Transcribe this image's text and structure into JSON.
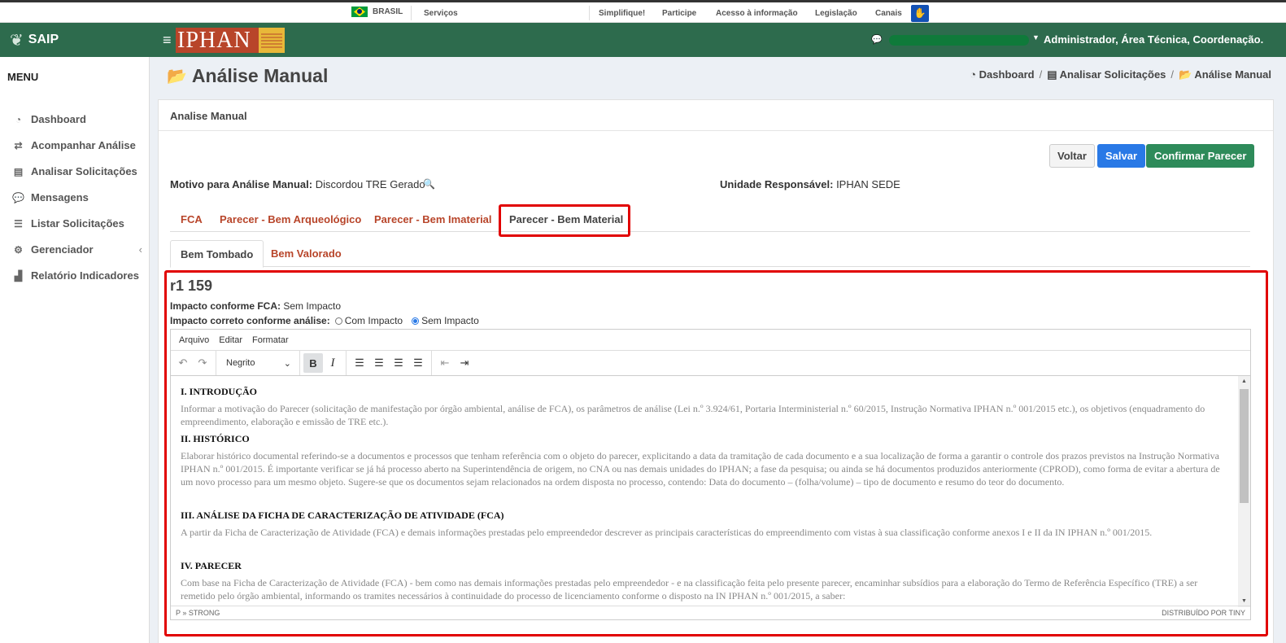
{
  "gov": {
    "country": "BRASIL",
    "links": [
      "Serviços",
      "Simplifique!",
      "Participe",
      "Acesso à informação",
      "Legislação",
      "Canais"
    ]
  },
  "app": {
    "name": "SAIP",
    "logo_text": "IPHAN"
  },
  "navbar": {
    "user": "Administrador, Área Técnica, Coordenação..."
  },
  "sidebar": {
    "title": "MENU",
    "items": [
      {
        "label": "Dashboard",
        "icon": "dashboard-icon"
      },
      {
        "label": "Acompanhar Análise",
        "icon": "exchange-icon"
      },
      {
        "label": "Analisar Solicitações",
        "icon": "book-icon"
      },
      {
        "label": "Mensagens",
        "icon": "comments-icon"
      },
      {
        "label": "Listar Solicitações",
        "icon": "list-icon"
      },
      {
        "label": "Gerenciador",
        "icon": "cogs-icon"
      },
      {
        "label": "Relatório Indicadores",
        "icon": "chart-icon"
      }
    ]
  },
  "page": {
    "title": "Análise Manual",
    "breadcrumb": [
      "Dashboard",
      "Analisar Solicitações",
      "Análise Manual"
    ],
    "breadcrumb_sep": "/"
  },
  "card": {
    "header": "Analise Manual",
    "buttons": {
      "voltar": "Voltar",
      "salvar": "Salvar",
      "confirmar": "Confirmar Parecer"
    },
    "motivo_label": "Motivo para Análise Manual:",
    "motivo_value": "Discordou TRE Gerado",
    "unidade_label": "Unidade Responsável:",
    "unidade_value": "IPHAN SEDE",
    "tabs": [
      "FCA",
      "Parecer - Bem Arqueológico",
      "Parecer - Bem Imaterial",
      "Parecer - Bem Material"
    ],
    "subtabs": [
      "Bem Tombado",
      "Bem Valorado"
    ],
    "section_title": "r1 159",
    "impacto_fca_label": "Impacto conforme FCA:",
    "impacto_fca_value": "Sem Impacto",
    "impacto_correto_label": "Impacto correto conforme análise:",
    "radio_com": "Com Impacto",
    "radio_sem": "Sem Impacto"
  },
  "editor": {
    "menu": [
      "Arquivo",
      "Editar",
      "Formatar"
    ],
    "format_select": "Negrito",
    "status_path": "P » STRONG",
    "branding": "DISTRIBUÍDO POR TINY",
    "sections": [
      {
        "title": "I. INTRODUÇÃO",
        "text": "Informar a motivação do Parecer (solicitação de manifestação por órgão ambiental, análise de FCA), os parâmetros de análise (Lei n.º 3.924/61, Portaria Interministerial n.º 60/2015, Instrução Normativa IPHAN n.º 001/2015 etc.), os objetivos (enquadramento do empreendimento, elaboração e emissão de TRE etc.)."
      },
      {
        "title": "II. HISTÓRICO",
        "text": "Elaborar histórico documental referindo-se a documentos e processos que tenham referência com o objeto do parecer, explicitando a data da tramitação de cada documento e a sua localização de forma a garantir o controle dos prazos previstos na Instrução Normativa IPHAN n.º 001/2015. É importante verificar se já há processo aberto na Superintendência de origem, no CNA ou nas demais unidades do IPHAN; a fase da pesquisa; ou ainda se há documentos produzidos anteriormente (CPROD), como forma de evitar a abertura de um novo processo para um mesmo objeto. Sugere-se que os documentos sejam relacionados na ordem disposta no processo, contendo: Data do documento – (folha/volume) – tipo de documento e resumo do teor do documento."
      },
      {
        "title": "III. ANÁLISE DA FICHA DE CARACTERIZAÇÃO DE ATIVIDADE (FCA)",
        "text": "A partir da Ficha de Caracterização de Atividade (FCA) e demais informações prestadas pelo empreendedor descrever as principais características do empreendimento com vistas à sua classificação conforme anexos I e II da IN IPHAN n.º 001/2015."
      },
      {
        "title": "IV. PARECER",
        "text": "Com base na Ficha de Caracterização de Atividade (FCA) - bem como nas demais informações prestadas pelo empreendedor - e na classificação feita pelo presente parecer, encaminhar subsídios para a elaboração do Termo de Referência Específico (TRE) a ser remetido pelo órgão ambiental, informando os tramites necessários à continuidade do processo de licenciamento conforme o disposto na IN IPHAN n.º 001/2015, a saber:"
      }
    ]
  },
  "colors": {
    "brand_green": "#2d6b4d",
    "link_red": "#b8452a",
    "highlight": "#e10000",
    "primary": "#2979e6",
    "success": "#2e8b5a"
  }
}
